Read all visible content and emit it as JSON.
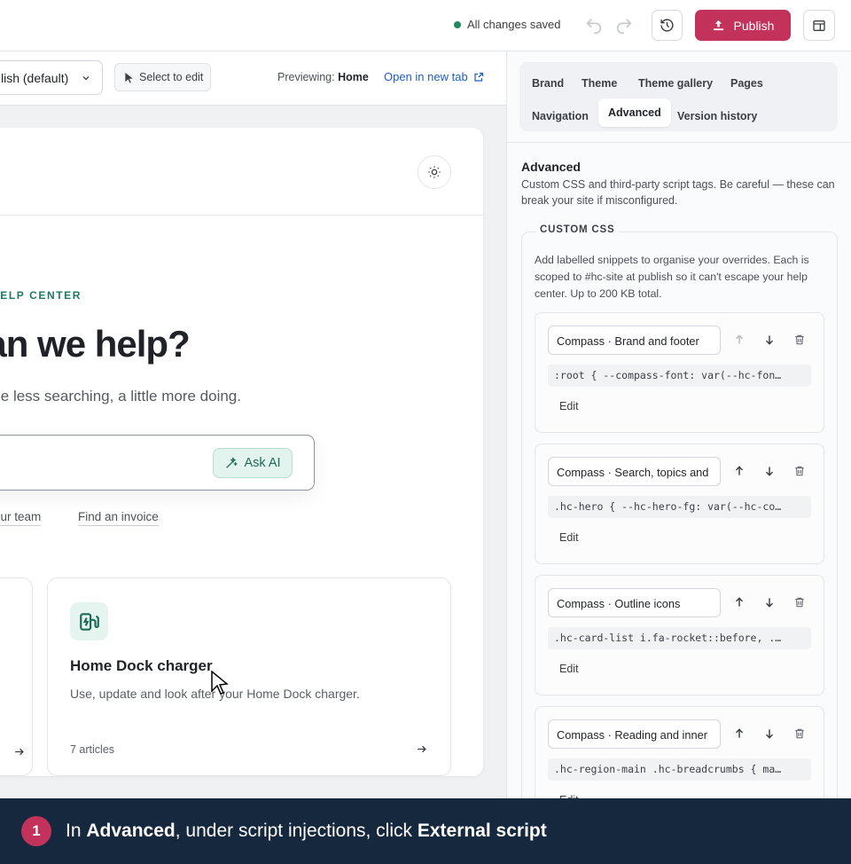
{
  "topbar": {
    "save_status": "All changes saved",
    "publish_label": "Publish"
  },
  "preview_toolbar": {
    "language_value": "lish (default)",
    "select_to_edit": "Select to edit",
    "previewing_label": "Previewing:",
    "previewing_page": "Home",
    "open_new_tab": "Open in new tab"
  },
  "site": {
    "eyebrow": "HELP CENTER",
    "hero_title": "can we help?",
    "hero_subtitle": "little less searching, a little more doing.",
    "ask_ai_label": "Ask AI",
    "quick_links": [
      "age your team",
      "Find an invoice"
    ],
    "card": {
      "title": "Home Dock charger",
      "description": "Use, update and look after your Home Dock charger.",
      "count": "7 articles"
    }
  },
  "panel": {
    "tabs": [
      "Brand",
      "Theme",
      "Theme gallery",
      "Pages",
      "Navigation",
      "Advanced",
      "Version history"
    ],
    "active_tab": "Advanced",
    "section_title": "Advanced",
    "section_desc": "Custom CSS and third-party script tags. Be careful — these can break your site if misconfigured.",
    "custom_css": {
      "legend": "CUSTOM CSS",
      "desc": "Add labelled snippets to organise your overrides. Each is scoped to #hc-site at publish so it can't escape your help center. Up to 200 KB total.",
      "edit_label": "Edit",
      "snippets": [
        {
          "name": "Compass · Brand and footer",
          "code": ":root { --compass-font: var(--hc-fon…"
        },
        {
          "name": "Compass · Search, topics and",
          "code": ".hc-hero { --hc-hero-fg: var(--hc-co…"
        },
        {
          "name": "Compass · Outline icons",
          "code": ".hc-card-list i.fa-rocket::before, .…"
        },
        {
          "name": "Compass · Reading and inner",
          "code": ".hc-region-main .hc-breadcrumbs { ma…"
        }
      ]
    }
  },
  "banner": {
    "step_number": "1",
    "text_pre": "In ",
    "text_bold1": "Advanced",
    "text_mid": ", under script injections, click ",
    "text_bold2": "External script"
  },
  "colors": {
    "accent": "#c2325b",
    "banner_bg": "#15283d",
    "brand_green": "#1f7a63"
  }
}
